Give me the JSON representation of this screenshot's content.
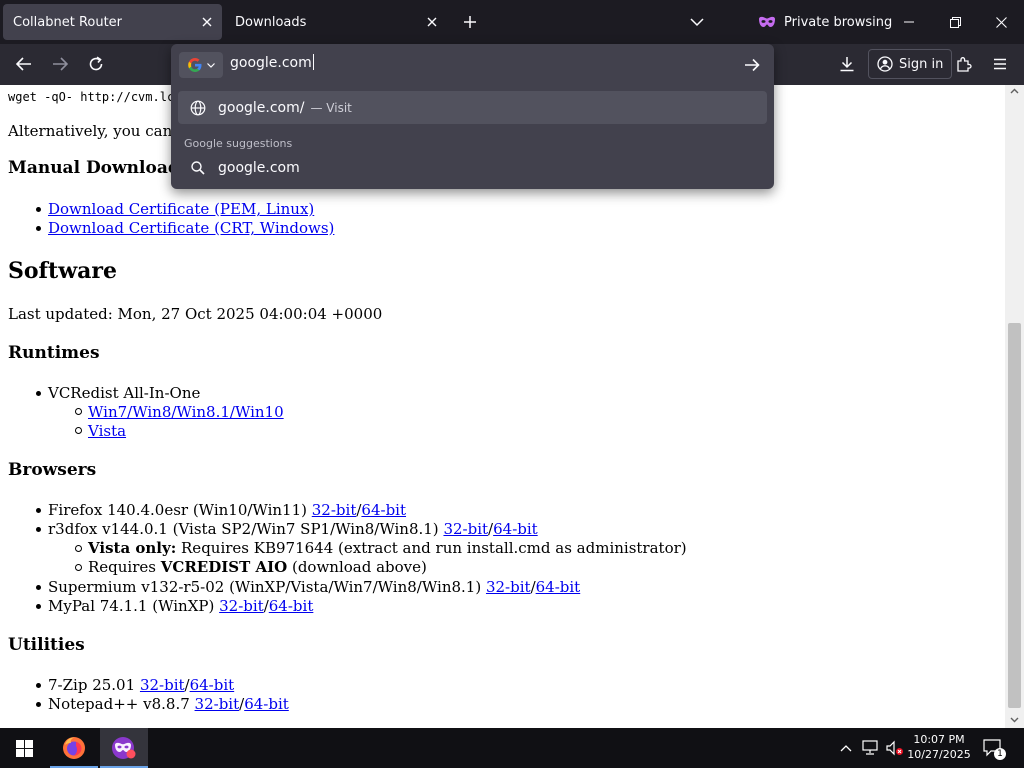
{
  "tabs": [
    {
      "title": "Collabnet Router",
      "active": true
    },
    {
      "title": "Downloads",
      "active": false
    }
  ],
  "private_label": "Private browsing",
  "signin_label": "Sign in",
  "urlbar": {
    "value": "google.com",
    "suggestions": [
      {
        "text": "google.com/",
        "action": "— Visit",
        "icon": "globe-icon"
      },
      {
        "text": "google.com",
        "icon": "search-icon"
      }
    ],
    "section_header": "Google suggestions"
  },
  "page": {
    "wget_line": "wget -qO- http://cvm.lc",
    "alt_line": "Alternatively, you can ma",
    "manual_heading": "Manual Download",
    "cert_links": [
      "Download Certificate (PEM, Linux)",
      "Download Certificate (CRT, Windows)"
    ],
    "software_heading": "Software",
    "last_updated": "Last updated: Mon, 27 Oct 2025 04:00:04 +0000",
    "runtimes": {
      "heading": "Runtimes",
      "item": "VCRedist All-In-One",
      "links": [
        "Win7/Win8/Win8.1/Win10",
        "Vista"
      ]
    },
    "browsers": {
      "heading": "Browsers",
      "firefox": "Firefox 140.4.0esr (Win10/Win11)",
      "r3dfox": "r3dfox v144.0.1 (Vista SP2/Win7 SP1/Win8/Win8.1)",
      "vista_only_bold": "Vista only:",
      "vista_only_rest": " Requires KB971644 (extract and run install.cmd as administrator)",
      "requires_text": "Requires ",
      "requires_bold": "VCREDIST AIO",
      "requires_rest": " (download above)",
      "supermium": "Supermium v132-r5-02 (WinXP/Vista/Win7/Win8/Win8.1)",
      "mypal": "MyPal 74.1.1 (WinXP)"
    },
    "utilities": {
      "heading": "Utilities",
      "zip": "7-Zip 25.01",
      "notepad": "Notepad++ v8.8.7"
    },
    "link_32": "32-bit",
    "link_64": "64-bit",
    "slash": "/"
  },
  "taskbar": {
    "time": "10:07 PM",
    "date": "10/27/2025",
    "notification_count": "1"
  },
  "colors": {
    "browser_chrome": "#1c1b22",
    "toolbar": "#2b2a33",
    "popup": "#42414d",
    "link": "#0000ee",
    "private_accent": "#c56cf0"
  }
}
